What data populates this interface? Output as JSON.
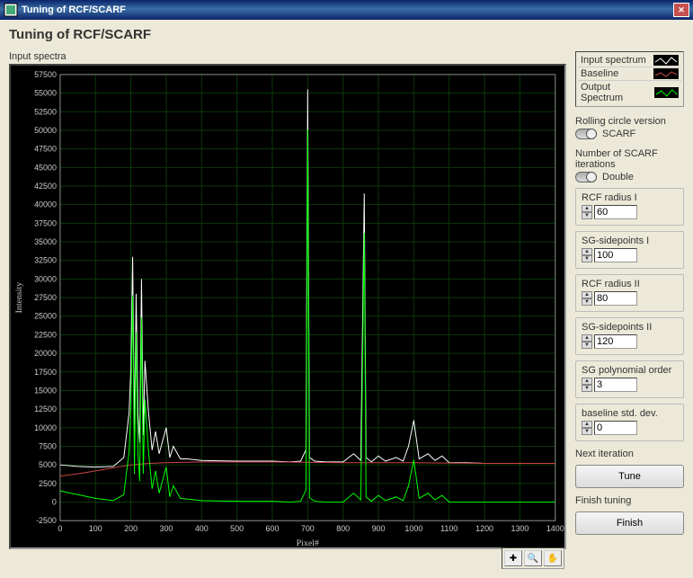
{
  "window": {
    "title": "Tuning of RCF/SCARF"
  },
  "page_title": "Tuning of RCF/SCARF",
  "plot_label": "Input spectra",
  "legend": [
    {
      "label": "Input spectrum",
      "color": "#ffffff"
    },
    {
      "label": "Baseline",
      "color": "#cc4444"
    },
    {
      "label": "Output Spectrum",
      "color": "#00ff00"
    }
  ],
  "toggles": {
    "rolling_circle": {
      "label": "Rolling circle version",
      "value": "SCARF"
    },
    "iterations": {
      "label": "Number of SCARF iterations",
      "value": "Double"
    }
  },
  "params": {
    "rcf_radius_1": {
      "label": "RCF radius I",
      "value": "60"
    },
    "sg_sidepoints_1": {
      "label": "SG-sidepoints I",
      "value": "100"
    },
    "rcf_radius_2": {
      "label": "RCF radius II",
      "value": "80"
    },
    "sg_sidepoints_2": {
      "label": "SG-sidepoints II",
      "value": "120"
    },
    "sg_poly_order": {
      "label": "SG polynomial order",
      "value": "3"
    },
    "baseline_std": {
      "label": "baseline std. dev.",
      "value": "0"
    }
  },
  "next_iteration": {
    "label": "Next iteration",
    "button": "Tune"
  },
  "finish_tuning": {
    "label": "Finish tuning",
    "button": "Finish"
  },
  "chart_data": {
    "type": "line",
    "xlabel": "Pixel#",
    "ylabel": "Intensity",
    "xlim": [
      0,
      1400
    ],
    "ylim": [
      -2500,
      57500
    ],
    "x_ticks": [
      0,
      100,
      200,
      300,
      400,
      500,
      600,
      700,
      800,
      900,
      1000,
      1100,
      1200,
      1300,
      1400
    ],
    "y_ticks": [
      -2500,
      0,
      2500,
      5000,
      7500,
      10000,
      12500,
      15000,
      17500,
      20000,
      22500,
      25000,
      27500,
      30000,
      32500,
      35000,
      37500,
      40000,
      42500,
      45000,
      47500,
      50000,
      52500,
      55000,
      57500
    ],
    "series": [
      {
        "name": "Input spectrum",
        "color": "#ffffff",
        "x": [
          0,
          50,
          100,
          150,
          180,
          195,
          200,
          205,
          210,
          215,
          220,
          225,
          230,
          235,
          240,
          250,
          260,
          270,
          280,
          300,
          310,
          320,
          340,
          360,
          400,
          500,
          600,
          650,
          680,
          695,
          700,
          705,
          720,
          750,
          800,
          830,
          850,
          860,
          865,
          880,
          900,
          920,
          950,
          970,
          985,
          1000,
          1015,
          1040,
          1060,
          1080,
          1100,
          1150,
          1200,
          1300,
          1400
        ],
        "values": [
          5000,
          4800,
          4700,
          4800,
          6000,
          12000,
          18000,
          33000,
          9000,
          28000,
          12000,
          8000,
          30000,
          9000,
          19000,
          12000,
          7000,
          9500,
          6500,
          10000,
          6000,
          7500,
          5800,
          5800,
          5600,
          5500,
          5500,
          5400,
          5500,
          7000,
          55500,
          6000,
          5500,
          5400,
          5400,
          6500,
          5600,
          41500,
          6000,
          5400,
          6200,
          5500,
          6000,
          5500,
          7500,
          11000,
          5800,
          6500,
          5600,
          6200,
          5300,
          5300,
          5200,
          5200,
          5200
        ]
      },
      {
        "name": "Baseline",
        "color": "#cc4444",
        "x": [
          0,
          50,
          100,
          150,
          200,
          250,
          300,
          400,
          600,
          800,
          1000,
          1200,
          1400
        ],
        "values": [
          3500,
          3800,
          4200,
          4600,
          5000,
          5200,
          5300,
          5400,
          5400,
          5300,
          5300,
          5200,
          5200
        ]
      },
      {
        "name": "Output Spectrum",
        "color": "#00ff00",
        "x": [
          0,
          50,
          100,
          150,
          180,
          195,
          200,
          205,
          210,
          215,
          220,
          225,
          230,
          235,
          240,
          250,
          260,
          270,
          280,
          300,
          310,
          320,
          340,
          360,
          400,
          500,
          600,
          650,
          680,
          695,
          700,
          705,
          720,
          750,
          800,
          830,
          850,
          860,
          865,
          880,
          900,
          920,
          950,
          970,
          985,
          1000,
          1015,
          1040,
          1060,
          1080,
          1100,
          1150,
          1200,
          1300,
          1400
        ],
        "values": [
          1500,
          1000,
          500,
          200,
          1000,
          6800,
          12800,
          27800,
          3800,
          22800,
          6800,
          2800,
          24800,
          3800,
          13800,
          6800,
          1800,
          4200,
          1200,
          4700,
          700,
          2200,
          500,
          400,
          200,
          100,
          100,
          0,
          100,
          1600,
          50100,
          600,
          100,
          0,
          0,
          1200,
          300,
          36200,
          700,
          100,
          900,
          200,
          700,
          200,
          2200,
          5700,
          500,
          1200,
          300,
          900,
          0,
          0,
          0,
          0,
          0
        ]
      }
    ]
  }
}
